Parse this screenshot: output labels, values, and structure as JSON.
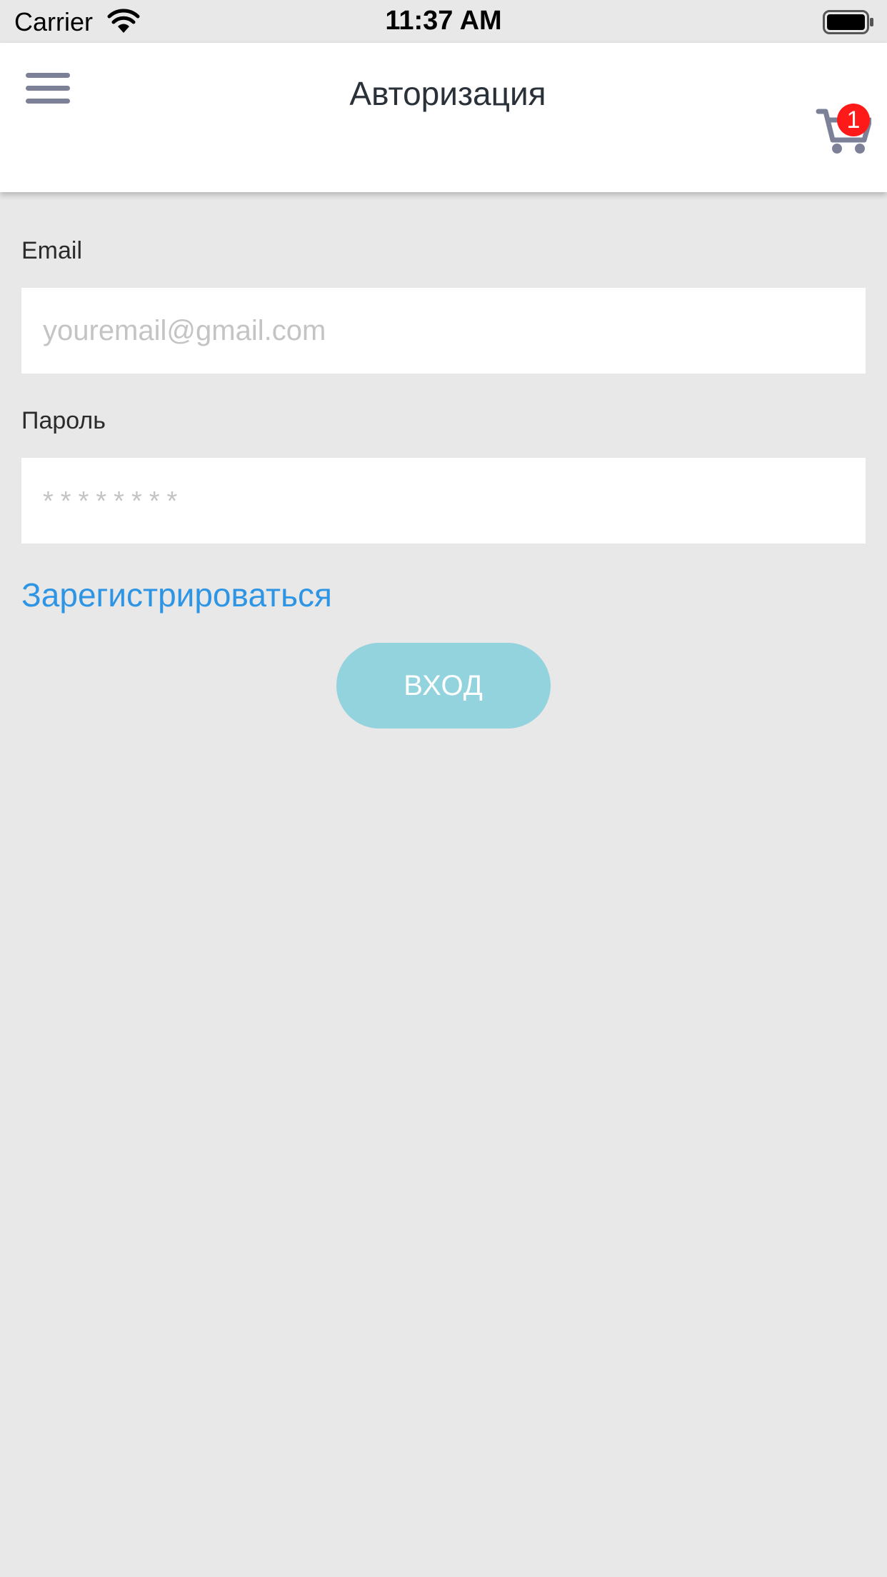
{
  "status_bar": {
    "carrier": "Carrier",
    "time": "11:37 AM"
  },
  "header": {
    "title": "Авторизация",
    "menu_icon": "hamburger-menu-icon",
    "cart_icon": "shopping-cart-icon",
    "cart_count": "1"
  },
  "form": {
    "email_label": "Email",
    "email_placeholder": "youremail@gmail.com",
    "email_value": "",
    "password_label": "Пароль",
    "password_placeholder": "********",
    "password_value": "",
    "register_link": "Зарегистрироваться",
    "login_button": "ВХОД"
  },
  "colors": {
    "background": "#e8e8e8",
    "link": "#2e95e4",
    "button": "#93d3dd",
    "badge": "#ff1a1a",
    "icon": "#7d8197"
  }
}
